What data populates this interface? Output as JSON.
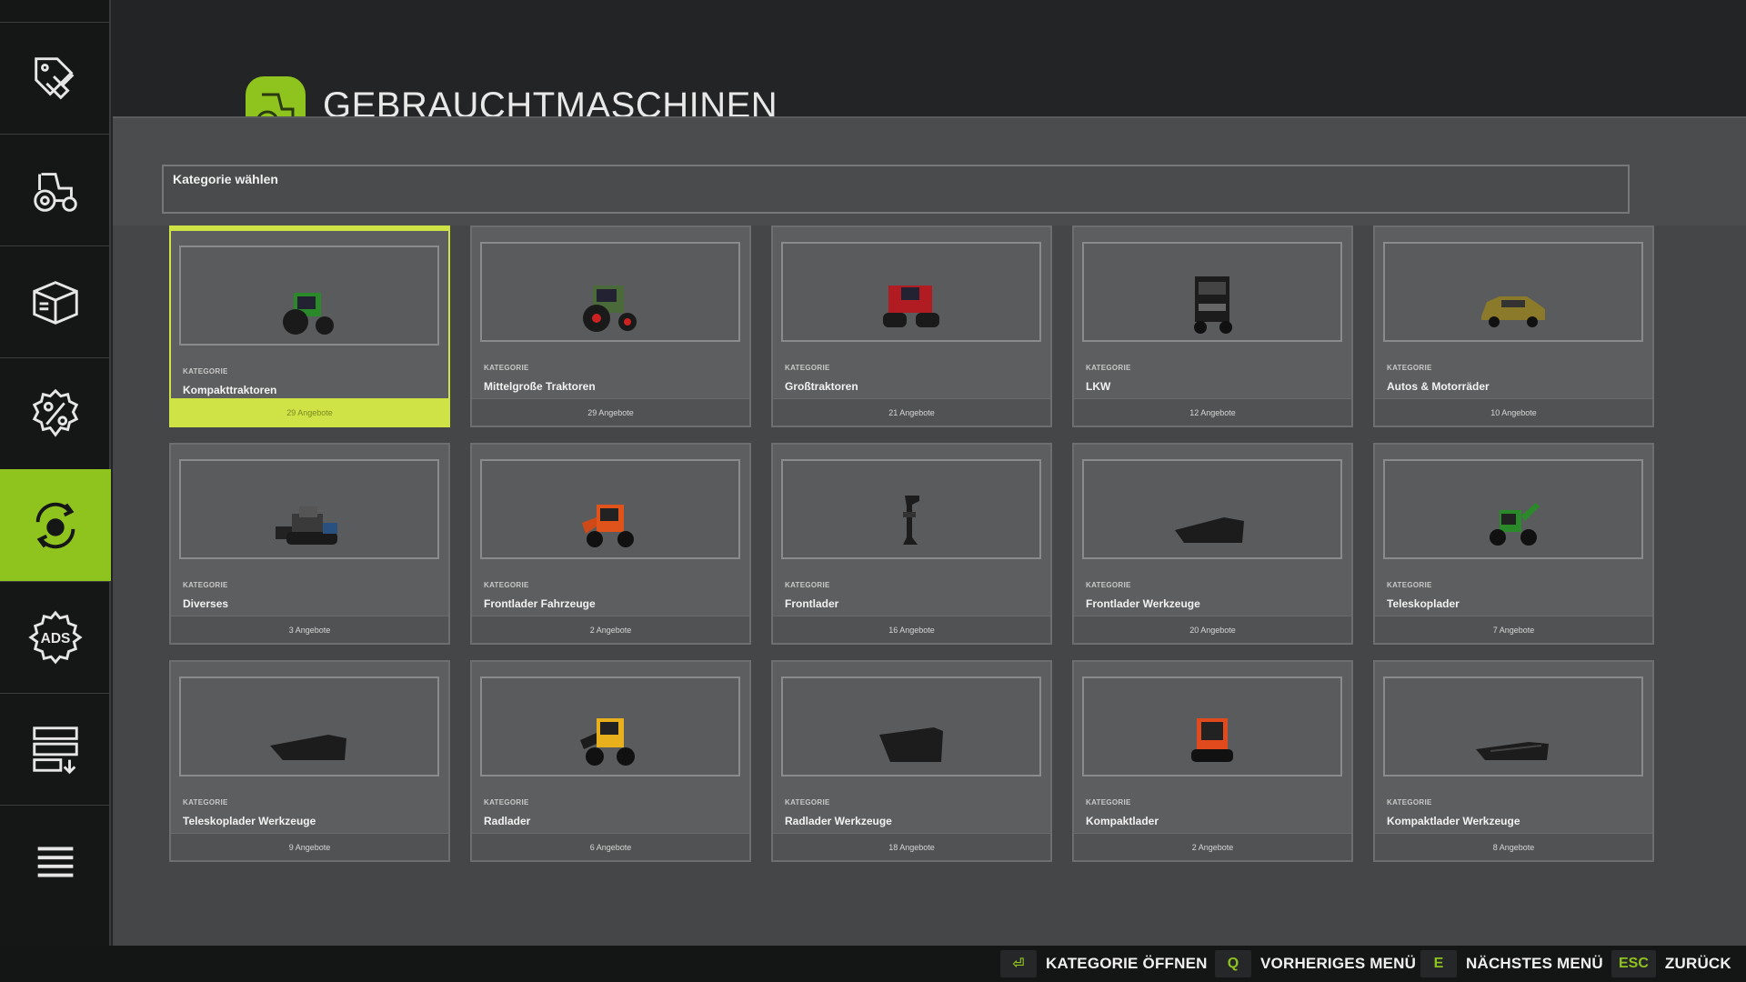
{
  "header": {
    "title": "GEBRAUCHTMASCHINEN",
    "icon": "tractor-icon"
  },
  "sidebar": {
    "items": [
      {
        "name": "price-tags-icon",
        "active": false
      },
      {
        "name": "tractor-icon",
        "active": false
      },
      {
        "name": "package-box-icon",
        "active": false
      },
      {
        "name": "sale-percent-icon",
        "active": false
      },
      {
        "name": "used-vehicles-icon",
        "active": true
      },
      {
        "name": "ads-gear-icon",
        "active": false
      },
      {
        "name": "download-list-icon",
        "active": false
      },
      {
        "name": "menu-icon",
        "active": false
      }
    ]
  },
  "category_select": {
    "label": "Kategorie wählen"
  },
  "cards": [
    {
      "kat": "KATEGORIE",
      "name": "Kompakttraktoren",
      "offers": "29 Angebote",
      "selected": true,
      "icon": "green-tractor-icon"
    },
    {
      "kat": "KATEGORIE",
      "name": "Mittelgroße Traktoren",
      "offers": "29 Angebote",
      "icon": "green-red-tractor-icon"
    },
    {
      "kat": "KATEGORIE",
      "name": "Großtraktoren",
      "offers": "21 Angebote",
      "icon": "red-track-tractor-icon"
    },
    {
      "kat": "KATEGORIE",
      "name": "LKW",
      "offers": "12 Angebote",
      "icon": "truck-icon"
    },
    {
      "kat": "KATEGORIE",
      "name": "Autos & Motorräder",
      "offers": "10 Angebote",
      "icon": "suv-car-icon"
    },
    {
      "kat": "KATEGORIE",
      "name": "Diverses",
      "offers": "3 Angebote",
      "icon": "snow-groomer-icon"
    },
    {
      "kat": "KATEGORIE",
      "name": "Frontlader Fahrzeuge",
      "offers": "2 Angebote",
      "icon": "orange-loader-icon"
    },
    {
      "kat": "KATEGORIE",
      "name": "Frontlader",
      "offers": "16 Angebote",
      "icon": "front-loader-arm-icon"
    },
    {
      "kat": "KATEGORIE",
      "name": "Frontlader Werkzeuge",
      "offers": "20 Angebote",
      "icon": "bucket-icon"
    },
    {
      "kat": "KATEGORIE",
      "name": "Teleskoplader",
      "offers": "7 Angebote",
      "icon": "telehandler-icon"
    },
    {
      "kat": "KATEGORIE",
      "name": "Teleskoplader Werkzeuge",
      "offers": "9 Angebote",
      "icon": "bucket-icon"
    },
    {
      "kat": "KATEGORIE",
      "name": "Radlader",
      "offers": "6 Angebote",
      "icon": "yellow-wheel-loader-icon"
    },
    {
      "kat": "KATEGORIE",
      "name": "Radlader Werkzeuge",
      "offers": "18 Angebote",
      "icon": "large-bucket-icon"
    },
    {
      "kat": "KATEGORIE",
      "name": "Kompaktlader",
      "offers": "2 Angebote",
      "icon": "skid-steer-icon"
    },
    {
      "kat": "KATEGORIE",
      "name": "Kompaktlader Werkzeuge",
      "offers": "8 Angebote",
      "icon": "flat-bucket-icon"
    }
  ],
  "bottom_hints": [
    {
      "key": "⏎",
      "label": "KATEGORIE ÖFFNEN"
    },
    {
      "key": "Q",
      "label": "VORHERIGES MENÜ"
    },
    {
      "key": "E",
      "label": "NÄCHSTES MENÜ"
    },
    {
      "key": "ESC",
      "label": "ZURÜCK"
    }
  ],
  "colors": {
    "accent": "#8fc31e",
    "selected": "#cfe347",
    "panel": "#454647",
    "card": "#5d5e5f"
  }
}
